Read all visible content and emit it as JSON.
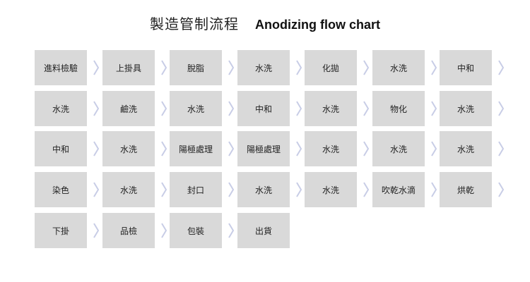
{
  "title": {
    "chinese": "製造管制流程",
    "english": "Anodizing flow chart"
  },
  "rows": [
    {
      "steps": [
        "進料檢驗",
        "上掛具",
        "脫脂",
        "水洗",
        "化拋",
        "水洗",
        "中和"
      ]
    },
    {
      "steps": [
        "水洗",
        "鹼洗",
        "水洗",
        "中和",
        "水洗",
        "物化",
        "水洗"
      ]
    },
    {
      "steps": [
        "中和",
        "水洗",
        "陽極處理",
        "陽極處理",
        "水洗",
        "水洗",
        "水洗"
      ]
    },
    {
      "steps": [
        "染色",
        "水洗",
        "封口",
        "水洗",
        "水洗",
        "吹乾水滴",
        "烘乾"
      ]
    },
    {
      "steps": [
        "下掛",
        "品檢",
        "包裝",
        "出貨"
      ]
    }
  ],
  "colors": {
    "box": "#d9d9d9",
    "arrow": "#c8cde6"
  },
  "icons": {
    "connector": "chevron-right-icon"
  }
}
